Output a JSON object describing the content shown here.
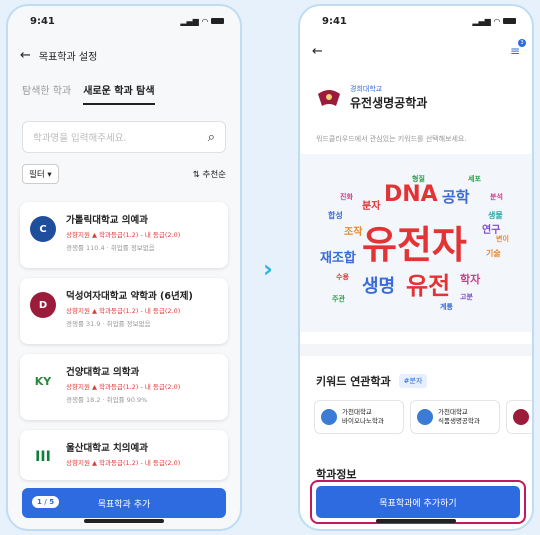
{
  "arrow": "›",
  "left": {
    "status": {
      "time": "9:41",
      "signal": "▂▄▆",
      "wifi": "◠"
    },
    "nav": {
      "back": "←",
      "title": "목표학과 설정"
    },
    "tabs": [
      {
        "label": "탐색한 학과",
        "active": false
      },
      {
        "label": "새로운 학과 탐색",
        "active": true
      }
    ],
    "search": {
      "placeholder": "학과명을 입력해주세요.",
      "icon": "search-icon"
    },
    "filter": {
      "label": "필터 ▾",
      "sort": "추천순",
      "sort_icon": "⇅"
    },
    "cards": [
      {
        "name": "가톨릭대학교 의예과",
        "line": "상향지원 ▲ 학과등급(1.2) - 내 등급(2.0)",
        "sub": "경쟁률 110.4 · 취업률 정보없음",
        "logo_color": "#1f4e9c",
        "logo_text": "C"
      },
      {
        "name": "덕성여자대학교 약학과 (6년제)",
        "line": "상향지원 ▲ 학과등급(1.2) - 내 등급(2.0)",
        "sub": "경쟁률 31.9 · 취업률 정보없음",
        "logo_color": "#9b1c3a",
        "logo_text": "D"
      },
      {
        "name": "건양대학교 의학과",
        "line": "상향지원 ▲ 학과등급(1.2) - 내 등급(2.0)",
        "sub": "경쟁률 18.2 · 취업률 90.9%",
        "logo_color": "#2a8a3c",
        "logo_text": "KY"
      },
      {
        "name": "울산대학교 치의예과",
        "line": "상향지원 ▲ 학과등급(1.2) - 내 등급(2.0)",
        "sub": "",
        "logo_color": "#0b7f3b",
        "logo_text": "III"
      }
    ],
    "bottom": {
      "page": "1 / 5",
      "label": "목표학과 추가"
    }
  },
  "right": {
    "status": {
      "time": "9:41",
      "signal": "▂▄▆",
      "wifi": "◠"
    },
    "nav": {
      "back": "←",
      "menu": "≡",
      "badge": "3"
    },
    "university": "경희대학교",
    "major": "유전생명공학과",
    "description": "워드클라우드에서 관심있는 키워드를 선택해보세요.",
    "cloud_words": [
      {
        "text": "유전자",
        "color": "#e23434"
      },
      {
        "text": "DNA",
        "color": "#e23434"
      },
      {
        "text": "공학",
        "color": "#3a6bd8"
      },
      {
        "text": "유전",
        "color": "#e23434"
      },
      {
        "text": "생명",
        "color": "#3a6bd8"
      },
      {
        "text": "재조합",
        "color": "#3a6bd8"
      },
      {
        "text": "학자",
        "color": "#d23c8a"
      },
      {
        "text": "분자",
        "color": "#e23434"
      },
      {
        "text": "조작",
        "color": "#e88a2e"
      },
      {
        "text": "생물",
        "color": "#2ea8a8"
      },
      {
        "text": "연구",
        "color": "#7d4cc9"
      },
      {
        "text": "기술",
        "color": "#e88a2e"
      },
      {
        "text": "세포",
        "color": "#2f9e4a"
      },
      {
        "text": "분석",
        "color": "#d23c8a"
      },
      {
        "text": "합성",
        "color": "#3a6bd8"
      },
      {
        "text": "주관",
        "color": "#2f9e4a"
      },
      {
        "text": "계통",
        "color": "#3a6bd8"
      },
      {
        "text": "변이",
        "color": "#e88a2e"
      },
      {
        "text": "수용",
        "color": "#e23434"
      },
      {
        "text": "고분",
        "color": "#7d4cc9"
      },
      {
        "text": "형질",
        "color": "#2f9e4a"
      },
      {
        "text": "진화",
        "color": "#d23c8a"
      }
    ],
    "keyword_section": {
      "title": "키워드 연관학과",
      "tag": "#분자"
    },
    "related": [
      {
        "uni": "가천대학교",
        "major": "바이오나노학과"
      },
      {
        "uni": "가천대학교",
        "major": "식품생명공학과"
      }
    ],
    "info_title": "학과정보",
    "cta": "목표학과에 추가하기"
  }
}
